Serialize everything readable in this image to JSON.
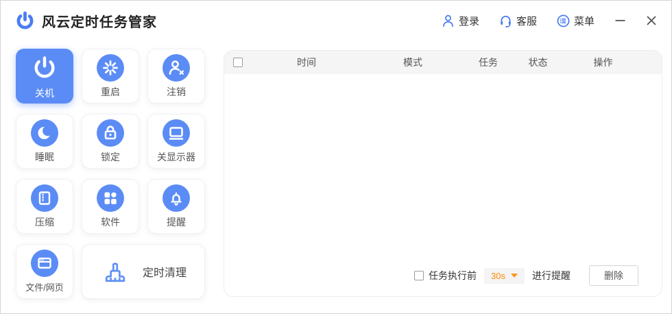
{
  "app": {
    "title": "风云定时任务管家"
  },
  "topbar": {
    "login": {
      "label": "登录"
    },
    "support": {
      "label": "客服"
    },
    "menu": {
      "label": "菜单"
    }
  },
  "sidebar": {
    "items": [
      {
        "label": "关机",
        "icon": "power-icon",
        "selected": true
      },
      {
        "label": "重启",
        "icon": "restart-icon",
        "selected": false
      },
      {
        "label": "注销",
        "icon": "logout-icon",
        "selected": false
      },
      {
        "label": "睡眠",
        "icon": "sleep-icon",
        "selected": false
      },
      {
        "label": "锁定",
        "icon": "lock-icon",
        "selected": false
      },
      {
        "label": "关显示器",
        "icon": "monitor-off-icon",
        "selected": false
      },
      {
        "label": "压缩",
        "icon": "compress-icon",
        "selected": false
      },
      {
        "label": "软件",
        "icon": "software-icon",
        "selected": false
      },
      {
        "label": "提醒",
        "icon": "bell-icon",
        "selected": false
      },
      {
        "label": "文件/网页",
        "icon": "browser-icon",
        "selected": false
      },
      {
        "label": "定时清理",
        "icon": "broom-icon",
        "selected": false,
        "wide": true
      }
    ]
  },
  "table": {
    "select_all_checked": false,
    "headers": [
      "时间",
      "模式",
      "任务",
      "状态",
      "操作"
    ],
    "rows": []
  },
  "footer": {
    "remind_checkbox_checked": false,
    "remind_before_label": "任务执行前",
    "interval_value": "30s",
    "remind_after_label": "进行提醒",
    "delete_label": "删除"
  },
  "colors": {
    "accent": "#5b8cf6",
    "topbar_icon_blue": "#4a7cf0",
    "orange": "#ff8a00"
  }
}
